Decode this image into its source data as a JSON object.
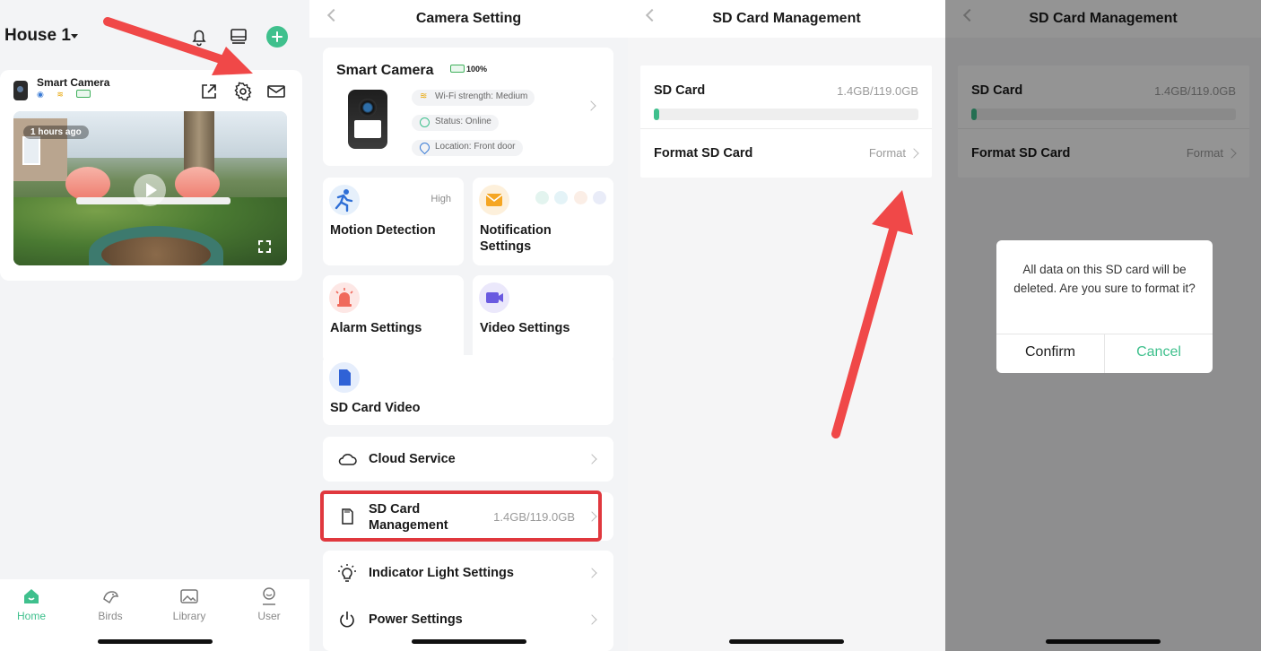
{
  "home": {
    "house_title": "House 1",
    "camera_name": "Smart Camera",
    "video_time": "1 hours ago",
    "tabs": [
      "Home",
      "Birds",
      "Library",
      "User"
    ],
    "active_tab": "Home"
  },
  "camera_setting": {
    "title": "Camera Setting",
    "camera_name": "Smart Camera",
    "battery": "100%",
    "wifi": "Wi-Fi strength: Medium",
    "status": "Status: Online",
    "location": "Location: Front door",
    "tiles": {
      "motion": {
        "label": "Motion Detection",
        "extra": "High"
      },
      "notification": {
        "label": "Notification Settings"
      },
      "alarm": {
        "label": "Alarm Settings"
      },
      "video": {
        "label": "Video Settings"
      },
      "sdvideo": {
        "label": "SD Card Video"
      }
    },
    "rows": {
      "cloud": "Cloud Service",
      "sd": "SD Card Management",
      "sd_value": "1.4GB/119.0GB",
      "indicator": "Indicator Light Settings",
      "power": "Power Settings"
    }
  },
  "sd_management": {
    "title": "SD Card Management",
    "sd_label": "SD Card",
    "sd_value": "1.4GB/119.0GB",
    "used_fraction": 0.012,
    "format_label": "Format SD Card",
    "format_action": "Format"
  },
  "dialog": {
    "message": "All data on this SD card will be deleted. Are you sure to format it?",
    "confirm": "Confirm",
    "cancel": "Cancel"
  },
  "colors": {
    "accent": "#3fc08d",
    "highlight": "#e0383e",
    "arrow": "#f04848"
  }
}
